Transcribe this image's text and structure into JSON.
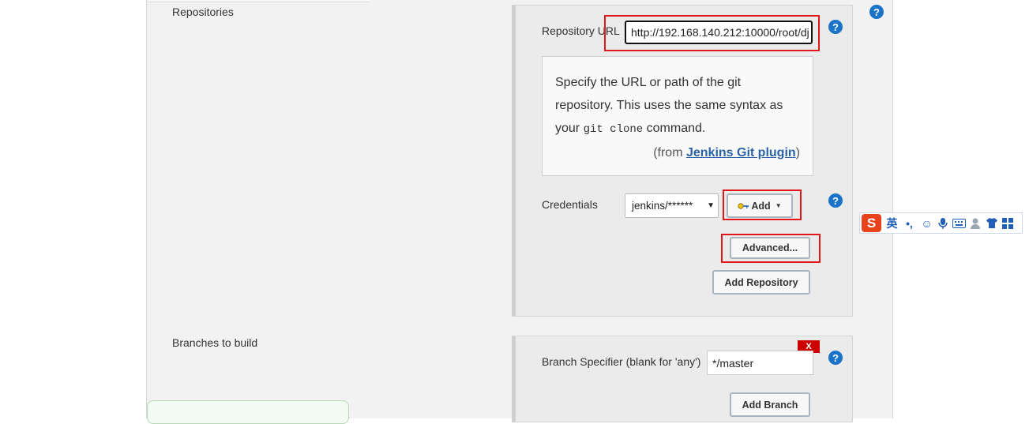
{
  "sections": {
    "repositories_label": "Repositories",
    "branches_label": "Branches to build"
  },
  "repository": {
    "url_label": "Repository URL",
    "url_value": "http://192.168.140.212:10000/root/dj",
    "help": {
      "line1": "Specify the URL or path of the git",
      "line2": "repository. This uses the same syntax as",
      "line3_prefix": "your ",
      "line3_code": "git clone",
      "line3_suffix": " command.",
      "from_prefix": "(from ",
      "from_link": "Jenkins Git plugin",
      "from_suffix": ")"
    },
    "credentials_label": "Credentials",
    "credentials_value": "jenkins/******",
    "add_label": "Add",
    "advanced_label": "Advanced...",
    "add_repository_label": "Add Repository"
  },
  "branch": {
    "specifier_label": "Branch Specifier (blank for 'any')",
    "specifier_value": "*/master",
    "add_branch_label": "Add Branch",
    "delete_label": "X"
  },
  "help_icon_glyph": "?",
  "ime_toolbar": {
    "logo": "S",
    "lang": "英"
  },
  "colors": {
    "highlight": "#e0161b",
    "help_icon": "#1a73c9",
    "link": "#2a64a6",
    "delete": "#cc0000"
  }
}
